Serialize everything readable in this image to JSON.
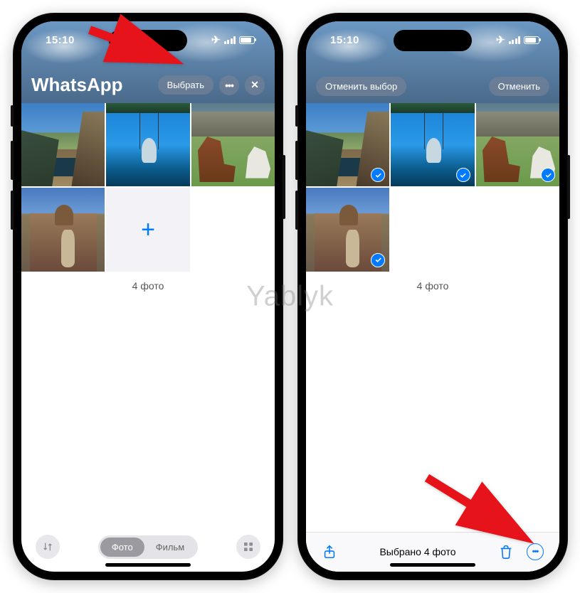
{
  "watermark": "Yablyk",
  "status": {
    "time": "15:10"
  },
  "left": {
    "title": "WhatsApp",
    "select_btn": "Выбрать",
    "count": "4 фото",
    "seg_photo": "Фото",
    "seg_film": "Фильм"
  },
  "right": {
    "deselect_btn": "Отменить выбор",
    "cancel_btn": "Отменить",
    "count": "4 фото",
    "selected_label": "Выбрано 4 фото"
  },
  "icons": {
    "more": "•••",
    "close": "✕",
    "add": "+"
  }
}
